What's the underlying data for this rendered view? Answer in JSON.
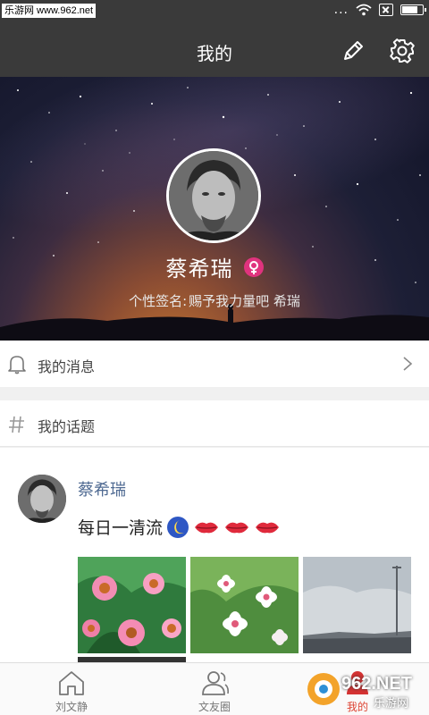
{
  "status_bar": {
    "watermark": "乐游网 www.962.net",
    "signal_dots": "..."
  },
  "header": {
    "title": "我的",
    "edit_icon": "pencil-icon",
    "settings_icon": "gear-icon"
  },
  "profile": {
    "name": "蔡希瑞",
    "gender_icon": "female-icon",
    "gender_color": "#e0337e",
    "signature_label": "个性签名:",
    "signature_text": "赐予我力量吧 希瑞"
  },
  "menu": {
    "messages": {
      "label": "我的消息",
      "icon": "bell-icon"
    },
    "topics": {
      "label": "我的话题",
      "icon": "hash-icon"
    }
  },
  "post": {
    "author": "蔡希瑞",
    "text": "每日一清流",
    "emojis": [
      "moon-icon",
      "lips-icon",
      "lips-icon",
      "lips-icon"
    ]
  },
  "tabs": [
    {
      "label": "刘文静",
      "icon": "home-icon"
    },
    {
      "label": "文友圈",
      "icon": "people-icon"
    },
    {
      "label": "我的",
      "icon": "profile-icon"
    }
  ],
  "watermark_br": {
    "logo": "962.NET",
    "sub": "乐游网"
  },
  "colors": {
    "header_bg": "#3a3a3a",
    "accent": "#d43333",
    "author_blue": "#4f6a92"
  }
}
